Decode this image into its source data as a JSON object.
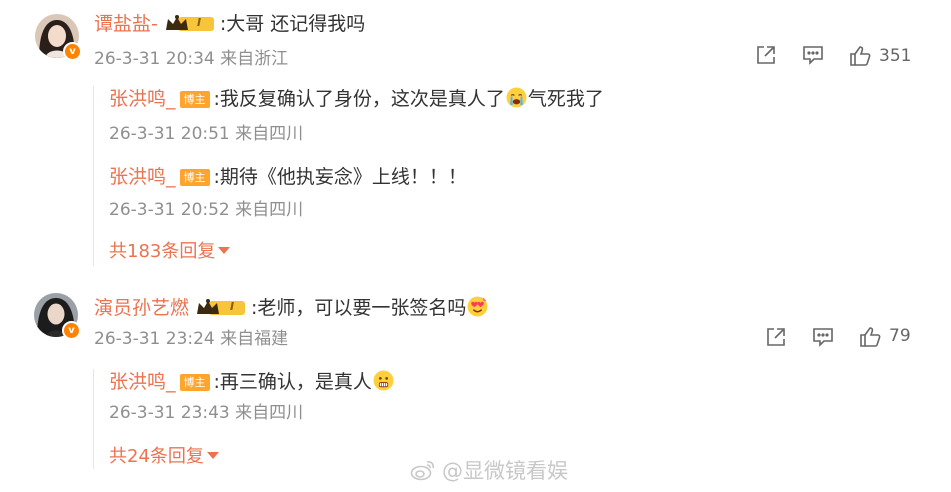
{
  "comments": [
    {
      "username": "谭盐盐-",
      "level": "I",
      "text": ":大哥 还记得我吗",
      "time": "26-3-31 20:34",
      "location": "来自浙江",
      "likes": "351",
      "replies": [
        {
          "username": "张洪鸣_",
          "badge": "博主",
          "text_a": ":我反复确认了身份，这次是真人了",
          "emoji": "crying-face",
          "text_b": "气死我了",
          "time": "26-3-31 20:51",
          "location": "来自四川"
        },
        {
          "username": "张洪鸣_",
          "badge": "博主",
          "text_a": ":期待《他执妄念》上线！！！",
          "time": "26-3-31 20:52",
          "location": "来自四川"
        }
      ],
      "more_replies": "共183条回复"
    },
    {
      "username": "演员孙艺燃",
      "level": "I",
      "text": ":老师，可以要一张签名吗",
      "emoji": "heart-eyes-face",
      "time": "26-3-31 23:24",
      "location": "来自福建",
      "likes": "79",
      "replies": [
        {
          "username": "张洪鸣_",
          "badge": "博主",
          "text_a": ":再三确认，是真人",
          "emoji": "scared-face",
          "time": "26-3-31 23:43",
          "location": "来自四川"
        }
      ],
      "more_replies": "共24条回复"
    }
  ],
  "verified_mark": "v",
  "watermark": "@显微镜看娱",
  "colors": {
    "username": "#eb7350",
    "meta": "#8f8f8f",
    "badge": "#ffa42d",
    "verified": "#ff8200"
  }
}
